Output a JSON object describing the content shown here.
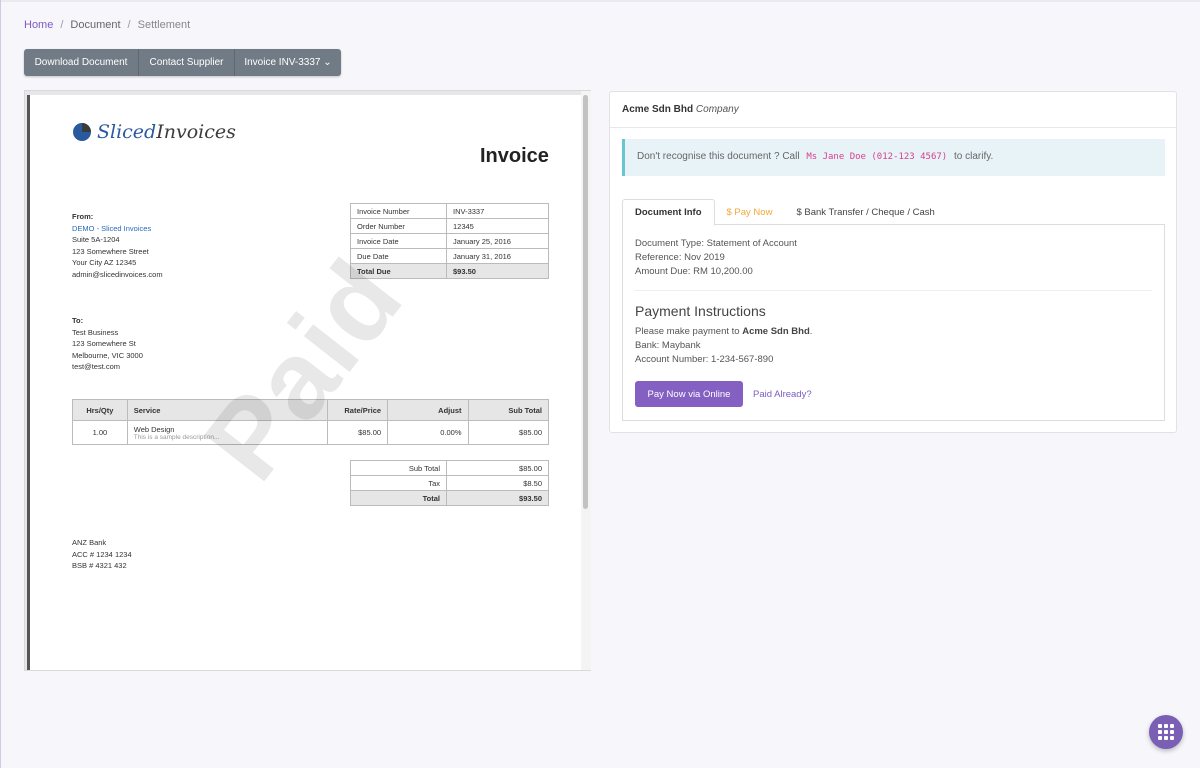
{
  "breadcrumb": {
    "home": "Home",
    "document": "Document",
    "current": "Settlement"
  },
  "toolbar": {
    "download": "Download Document",
    "contact": "Contact Supplier",
    "invoice": "Invoice INV-3337 ⌄"
  },
  "invoice": {
    "logo_a": "Sliced",
    "logo_b": "Invoices",
    "title": "Invoice",
    "from": {
      "heading": "From:",
      "name": "DEMO - Sliced Invoices",
      "lines": [
        "Suite 5A-1204",
        "123 Somewhere Street",
        "Your City AZ 12345",
        "admin@slicedinvoices.com"
      ]
    },
    "to": {
      "heading": "To:",
      "lines": [
        "Test Business",
        "123 Somewhere St",
        "Melbourne, VIC 3000",
        "test@test.com"
      ]
    },
    "meta": [
      [
        "Invoice Number",
        "INV-3337"
      ],
      [
        "Order Number",
        "12345"
      ],
      [
        "Invoice Date",
        "January 25, 2016"
      ],
      [
        "Due Date",
        "January 31, 2016"
      ],
      [
        "Total Due",
        "$93.50"
      ]
    ],
    "items_header": [
      "Hrs/Qty",
      "Service",
      "Rate/Price",
      "Adjust",
      "Sub Total"
    ],
    "item": {
      "qty": "1.00",
      "service": "Web Design",
      "desc": "This is a sample description...",
      "rate": "$85.00",
      "adjust": "0.00%",
      "subtotal": "$85.00"
    },
    "totals": [
      [
        "Sub Total",
        "$85.00"
      ],
      [
        "Tax",
        "$8.50"
      ],
      [
        "Total",
        "$93.50"
      ]
    ],
    "bank": [
      "ANZ Bank",
      "ACC # 1234 1234",
      "BSB # 4321 432"
    ],
    "watermark": "Paid"
  },
  "panel": {
    "company": "Acme Sdn Bhd",
    "company_type": "Company",
    "alert_pre": "Don't recognise this document ? Call",
    "alert_code": "Ms Jane Doe (012-123 4567)",
    "alert_post": "to clarify.",
    "tabs": [
      "Document Info",
      "$ Pay Now",
      "$ Bank Transfer / Cheque / Cash"
    ],
    "info": [
      "Document Type: Statement of Account",
      "Reference: Nov 2019",
      "Amount Due: RM 10,200.00"
    ],
    "pi_title": "Payment Instructions",
    "pi_text": "Please make payment to",
    "pi_company": "Acme Sdn Bhd",
    "pi_period": ".",
    "pi_bank": "Bank: Maybank",
    "pi_account": "Account Number: 1-234-567-890",
    "pay_button": "Pay Now via Online",
    "paid_link": "Paid Already?"
  },
  "colors": {
    "accent": "#8460c2",
    "button_gray": "#717b85",
    "alert_border": "#69c5cf",
    "pay_tab": "#f0a83a",
    "code": "#d6408f"
  },
  "icons": {
    "fab": "grid-menu-icon",
    "logo": "pie-chart-icon"
  }
}
